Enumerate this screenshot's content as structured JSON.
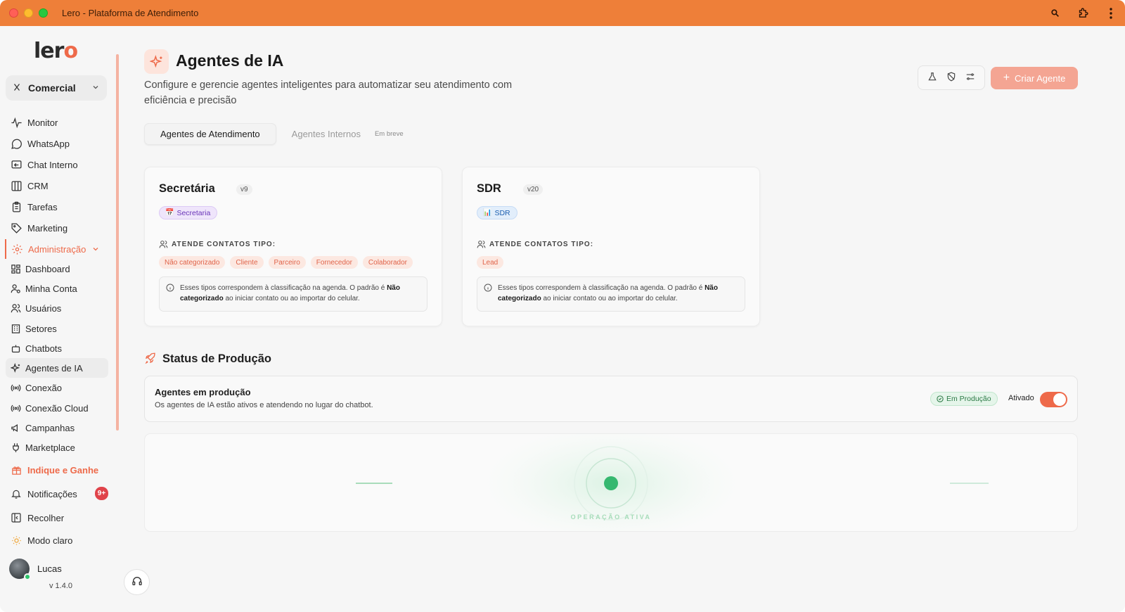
{
  "window": {
    "title": "Lero - Plataforma de Atendimento"
  },
  "sidebar": {
    "logo_text": "lero",
    "org_selector": {
      "label": "Comercial"
    },
    "nav": [
      {
        "label": "Monitor",
        "icon": "activity-icon"
      },
      {
        "label": "WhatsApp",
        "icon": "whatsapp-icon"
      },
      {
        "label": "Chat Interno",
        "icon": "chat-icon"
      },
      {
        "label": "CRM",
        "icon": "columns-icon"
      },
      {
        "label": "Tarefas",
        "icon": "clipboard-icon"
      },
      {
        "label": "Marketing",
        "icon": "tag-icon"
      }
    ],
    "admin": {
      "label": "Administração",
      "items": [
        {
          "label": "Dashboard",
          "icon": "dashboard-icon"
        },
        {
          "label": "Minha Conta",
          "icon": "user-settings-icon"
        },
        {
          "label": "Usuários",
          "icon": "users-icon"
        },
        {
          "label": "Setores",
          "icon": "building-icon"
        },
        {
          "label": "Chatbots",
          "icon": "bot-icon"
        },
        {
          "label": "Agentes de IA",
          "icon": "sparkles-icon",
          "active": true
        },
        {
          "label": "Conexão",
          "icon": "radio-icon"
        },
        {
          "label": "Conexão Cloud",
          "icon": "radio-icon"
        },
        {
          "label": "Campanhas",
          "icon": "megaphone-icon"
        },
        {
          "label": "Marketplace",
          "icon": "plug-icon"
        }
      ]
    },
    "referral": {
      "label": "Indique e Ganhe",
      "icon": "gift-icon"
    },
    "notifications": {
      "label": "Notificações",
      "count": "9+"
    },
    "collapse": {
      "label": "Recolher"
    },
    "theme": {
      "label": "Modo claro"
    },
    "user": {
      "name": "Lucas"
    },
    "version": "v 1.4.0"
  },
  "header": {
    "title": "Agentes de IA",
    "subtitle": "Configure e gerencie agentes inteligentes para automatizar seu atendimento com eficiência e precisão",
    "create_button": "Criar Agente"
  },
  "tabs": [
    {
      "label": "Agentes de Atendimento",
      "active": true
    },
    {
      "label": "Agentes Internos",
      "active": false,
      "badge": "Em breve"
    }
  ],
  "agents": [
    {
      "name": "Secretária",
      "version": "v9",
      "category": "Secretaria",
      "category_emoji": "📅",
      "attends_label": "ATENDE CONTATOS TIPO:",
      "contact_types": [
        "Não categorizado",
        "Cliente",
        "Parceiro",
        "Fornecedor",
        "Colaborador"
      ],
      "info_pre": "Esses tipos correspondem à classificação na agenda. O padrão é ",
      "info_bold": "Não categorizado",
      "info_post": " ao iniciar contato ou ao importar do celular."
    },
    {
      "name": "SDR",
      "version": "v20",
      "category": "SDR",
      "category_emoji": "📊",
      "attends_label": "ATENDE CONTATOS TIPO:",
      "contact_types": [
        "Lead"
      ],
      "info_pre": "Esses tipos correspondem à classificação na agenda. O padrão é ",
      "info_bold": "Não categorizado",
      "info_post": " ao iniciar contato ou ao importar do celular."
    }
  ],
  "production": {
    "section_title": "Status de Produção",
    "heading": "Agentes em produção",
    "description": "Os agentes de IA estão ativos e atendendo no lugar do chatbot.",
    "badge": "Em Produção",
    "toggle_label": "Ativado",
    "toggle_on": true,
    "visual_label": "OPERAÇÃO ATIVA"
  },
  "colors": {
    "titlebar": "#ee7f39",
    "accent": "#ee6a4a",
    "success": "#2ec46a",
    "status_dot": "#36b870"
  }
}
